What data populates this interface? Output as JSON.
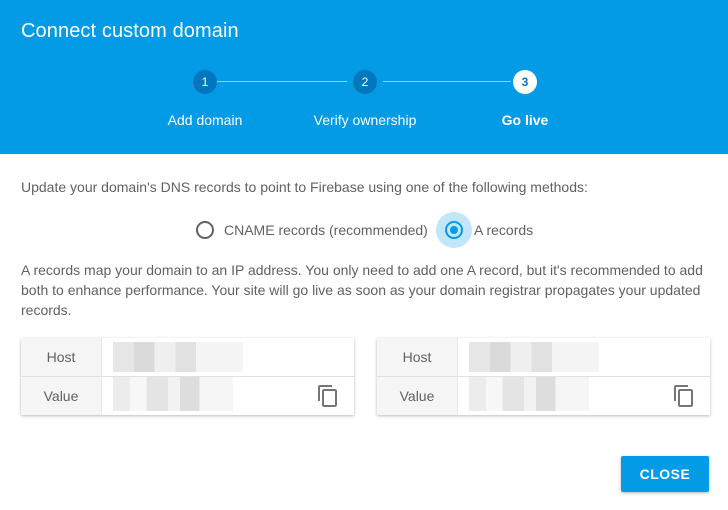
{
  "dialog": {
    "title": "Connect custom domain"
  },
  "steps": [
    {
      "number": "1",
      "label": "Add domain",
      "state": "done"
    },
    {
      "number": "2",
      "label": "Verify ownership",
      "state": "done"
    },
    {
      "number": "3",
      "label": "Go live",
      "state": "active"
    }
  ],
  "content": {
    "intro": "Update your domain's DNS records to point to Firebase using one of the following methods:",
    "methods": [
      {
        "label": "CNAME records (recommended)",
        "selected": false
      },
      {
        "label": "A records",
        "selected": true
      }
    ],
    "description": "A records map your domain to an IP address. You only need to add one A record, but it's recommended to add both to enhance performance. Your site will go live as soon as your domain registrar propagates your updated records."
  },
  "records": [
    {
      "host_label": "Host",
      "value_label": "Value",
      "copy_icon": "copy-icon"
    },
    {
      "host_label": "Host",
      "value_label": "Value",
      "copy_icon": "copy-icon"
    }
  ],
  "actions": {
    "close_label": "CLOSE"
  },
  "colors": {
    "header": "#039be5",
    "step_done": "#0277bd",
    "accent": "#039be5"
  }
}
